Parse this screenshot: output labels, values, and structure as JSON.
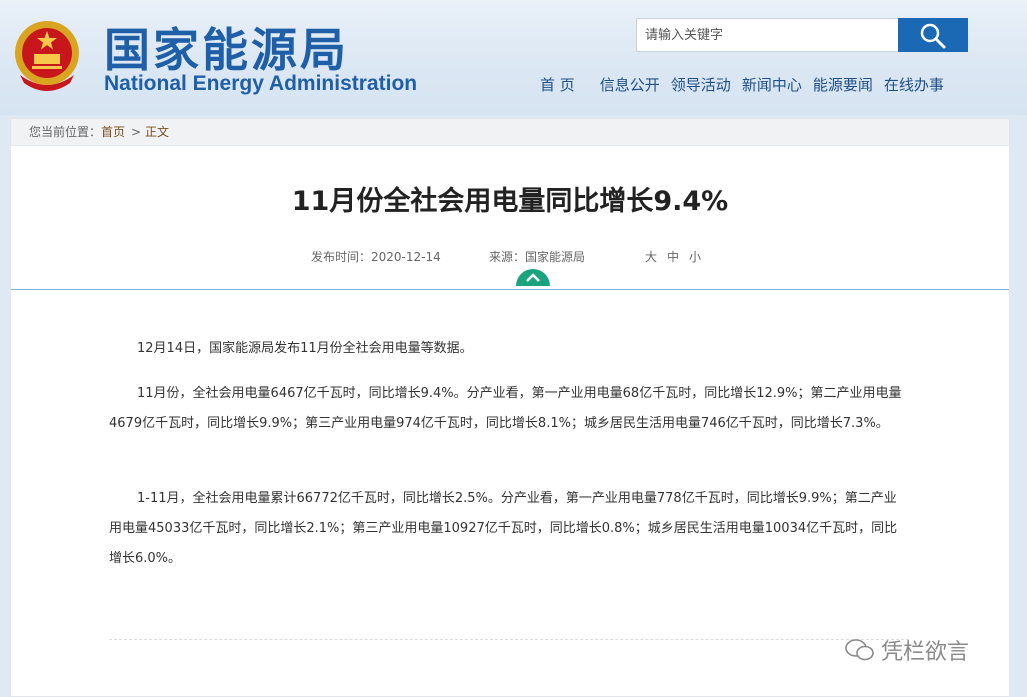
{
  "header": {
    "site_name_cn": "国家能源局",
    "site_name_en": "National Energy Administration",
    "search_placeholder": "请输入关键字",
    "nav": [
      "首 页",
      "信息公开",
      "领导活动",
      "新闻中心",
      "能源要闻",
      "在线办事"
    ]
  },
  "breadcrumb": {
    "prefix": "您当前位置：",
    "home": "首页",
    "sep": ">",
    "current": "正文"
  },
  "article": {
    "title": "11月份全社会用电量同比增长9.4%",
    "publish_label": "发布时间：2020-12-14",
    "source_label": "来源：国家能源局",
    "font_sizes": [
      "大",
      "中",
      "小"
    ],
    "paragraphs": [
      "12月14日，国家能源局发布11月份全社会用电量等数据。",
      "11月份，全社会用电量6467亿千瓦时，同比增长9.4%。分产业看，第一产业用电量68亿千瓦时，同比增长12.9%；第二产业用电量4679亿千瓦时，同比增长9.9%；第三产业用电量974亿千瓦时，同比增长8.1%；城乡居民生活用电量746亿千瓦时，同比增长7.3%。",
      "1-11月，全社会用电量累计66772亿千瓦时，同比增长2.5%。分产业看，第一产业用电量778亿千瓦时，同比增长9.9%；第二产业用电量45033亿千瓦时，同比增长2.1%；第三产业用电量10927亿千瓦时，同比增长0.8%；城乡居民生活用电量10034亿千瓦时，同比增长6.0%。"
    ]
  },
  "watermark": "凭栏欲言",
  "colors": {
    "brand_blue": "#1f5fa8",
    "search_button": "#1b68b5",
    "toggle_green": "#1aa37d"
  }
}
